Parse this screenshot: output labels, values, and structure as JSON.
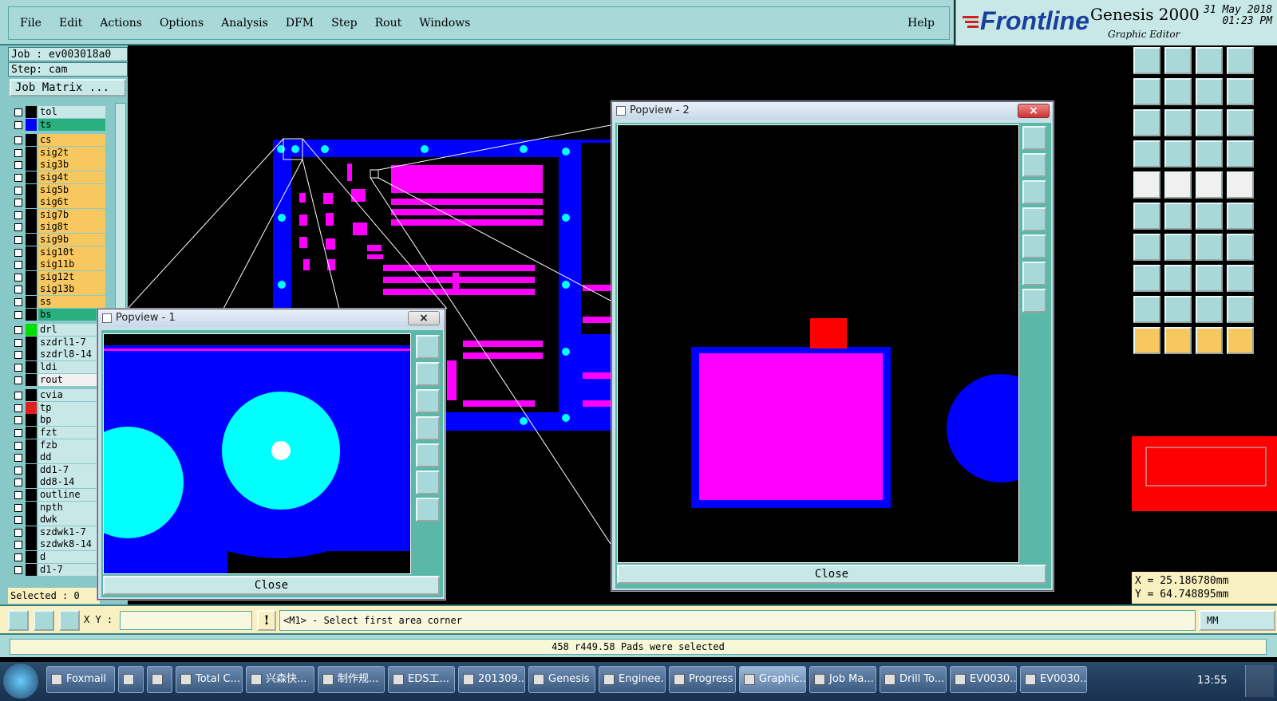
{
  "menu": {
    "items": [
      "File",
      "Edit",
      "Actions",
      "Options",
      "Analysis",
      "DFM",
      "Step",
      "Rout",
      "Windows"
    ],
    "help": "Help"
  },
  "brand": {
    "logo": "Frontline",
    "product": "Genesis 2000",
    "subtitle": "Graphic Editor",
    "date": "31 May 2018",
    "time": "01:23 PM"
  },
  "job": {
    "job_label": "Job : ev003018a0",
    "step_label": "Step: cam",
    "matrix_button": "Job Matrix ..."
  },
  "layers": [
    {
      "name": "tol",
      "bg": "#c8e8e8",
      "swatch": "#000000"
    },
    {
      "name": "ts",
      "bg": "#2ab080",
      "swatch": "#0000ff"
    },
    {
      "name": "cs",
      "bg": "#f8c860",
      "swatch": "#000000"
    },
    {
      "name": "sig2t",
      "bg": "#f8c860",
      "swatch": "#000000"
    },
    {
      "name": "sig3b",
      "bg": "#f8c860",
      "swatch": "#000000"
    },
    {
      "name": "sig4t",
      "bg": "#f8c860",
      "swatch": "#000000"
    },
    {
      "name": "sig5b",
      "bg": "#f8c860",
      "swatch": "#000000"
    },
    {
      "name": "sig6t",
      "bg": "#f8c860",
      "swatch": "#000000"
    },
    {
      "name": "sig7b",
      "bg": "#f8c860",
      "swatch": "#000000"
    },
    {
      "name": "sig8t",
      "bg": "#f8c860",
      "swatch": "#000000"
    },
    {
      "name": "sig9b",
      "bg": "#f8c860",
      "swatch": "#000000"
    },
    {
      "name": "sig10t",
      "bg": "#f8c860",
      "swatch": "#000000"
    },
    {
      "name": "sig11b",
      "bg": "#f8c860",
      "swatch": "#000000"
    },
    {
      "name": "sig12t",
      "bg": "#f8c860",
      "swatch": "#000000"
    },
    {
      "name": "sig13b",
      "bg": "#f8c860",
      "swatch": "#000000"
    },
    {
      "name": "ss",
      "bg": "#f8c860",
      "swatch": "#000000"
    },
    {
      "name": "bs",
      "bg": "#2ab080",
      "swatch": "#000000"
    },
    {
      "name": "drl",
      "bg": "#c8e8e8",
      "swatch": "#00e000"
    },
    {
      "name": "szdrl1-7",
      "bg": "#c8e8e8",
      "swatch": "#000000"
    },
    {
      "name": "szdrl8-14",
      "bg": "#c8e8e8",
      "swatch": "#000000"
    },
    {
      "name": "ldi",
      "bg": "#c8e8e8",
      "swatch": "#000000"
    },
    {
      "name": "rout",
      "bg": "#f0f0f0",
      "swatch": "#000000"
    },
    {
      "name": "cvia",
      "bg": "#c8e8e8",
      "swatch": "#000000"
    },
    {
      "name": "tp",
      "bg": "#c8e8e8",
      "swatch": "#e02020"
    },
    {
      "name": "bp",
      "bg": "#c8e8e8",
      "swatch": "#000000"
    },
    {
      "name": "fzt",
      "bg": "#c8e8e8",
      "swatch": "#000000"
    },
    {
      "name": "fzb",
      "bg": "#c8e8e8",
      "swatch": "#000000"
    },
    {
      "name": "dd",
      "bg": "#c8e8e8",
      "swatch": "#000000"
    },
    {
      "name": "dd1-7",
      "bg": "#c8e8e8",
      "swatch": "#000000"
    },
    {
      "name": "dd8-14",
      "bg": "#c8e8e8",
      "swatch": "#000000"
    },
    {
      "name": "outline",
      "bg": "#c8e8e8",
      "swatch": "#000000"
    },
    {
      "name": "npth",
      "bg": "#c8e8e8",
      "swatch": "#000000"
    },
    {
      "name": "dwk",
      "bg": "#c8e8e8",
      "swatch": "#000000"
    },
    {
      "name": "szdwk1-7",
      "bg": "#c8e8e8",
      "swatch": "#000000"
    },
    {
      "name": "szdwk8-14",
      "bg": "#c8e8e8",
      "swatch": "#000000"
    },
    {
      "name": "d",
      "bg": "#c8e8e8",
      "swatch": "#000000"
    },
    {
      "name": "d1-7",
      "bg": "#c8e8e8",
      "swatch": "#000000"
    }
  ],
  "selected": "Selected : 0",
  "popup1": {
    "title": "Popview - 1",
    "close": "Close"
  },
  "popup2": {
    "title": "Popview - 2",
    "close": "Close"
  },
  "coords": {
    "x": "X = 25.186780mm",
    "y": "Y = 64.748895mm"
  },
  "cmd": {
    "xy_label": "X Y :",
    "xy_value": "",
    "prompt": "<M1> - Select first area corner",
    "units": "MM"
  },
  "status": "458 r449.58 Pads were selected",
  "taskbar": {
    "items": [
      "Foxmail",
      "",
      "",
      "Total C...",
      "兴森快...",
      "制作规...",
      "EDS工...",
      "201309...",
      "Genesis",
      "Enginee...",
      "Progress",
      "Graphic...",
      "Job Ma...",
      "Drill To...",
      "EV0030...",
      "EV0030..."
    ],
    "clock": "13:55"
  },
  "colors": {
    "panel": "#a8d8d8",
    "accent": "#3a8080",
    "board_blue": "#0000ff",
    "pad_magenta": "#ff00ff",
    "hole_cyan": "#00ffff"
  }
}
